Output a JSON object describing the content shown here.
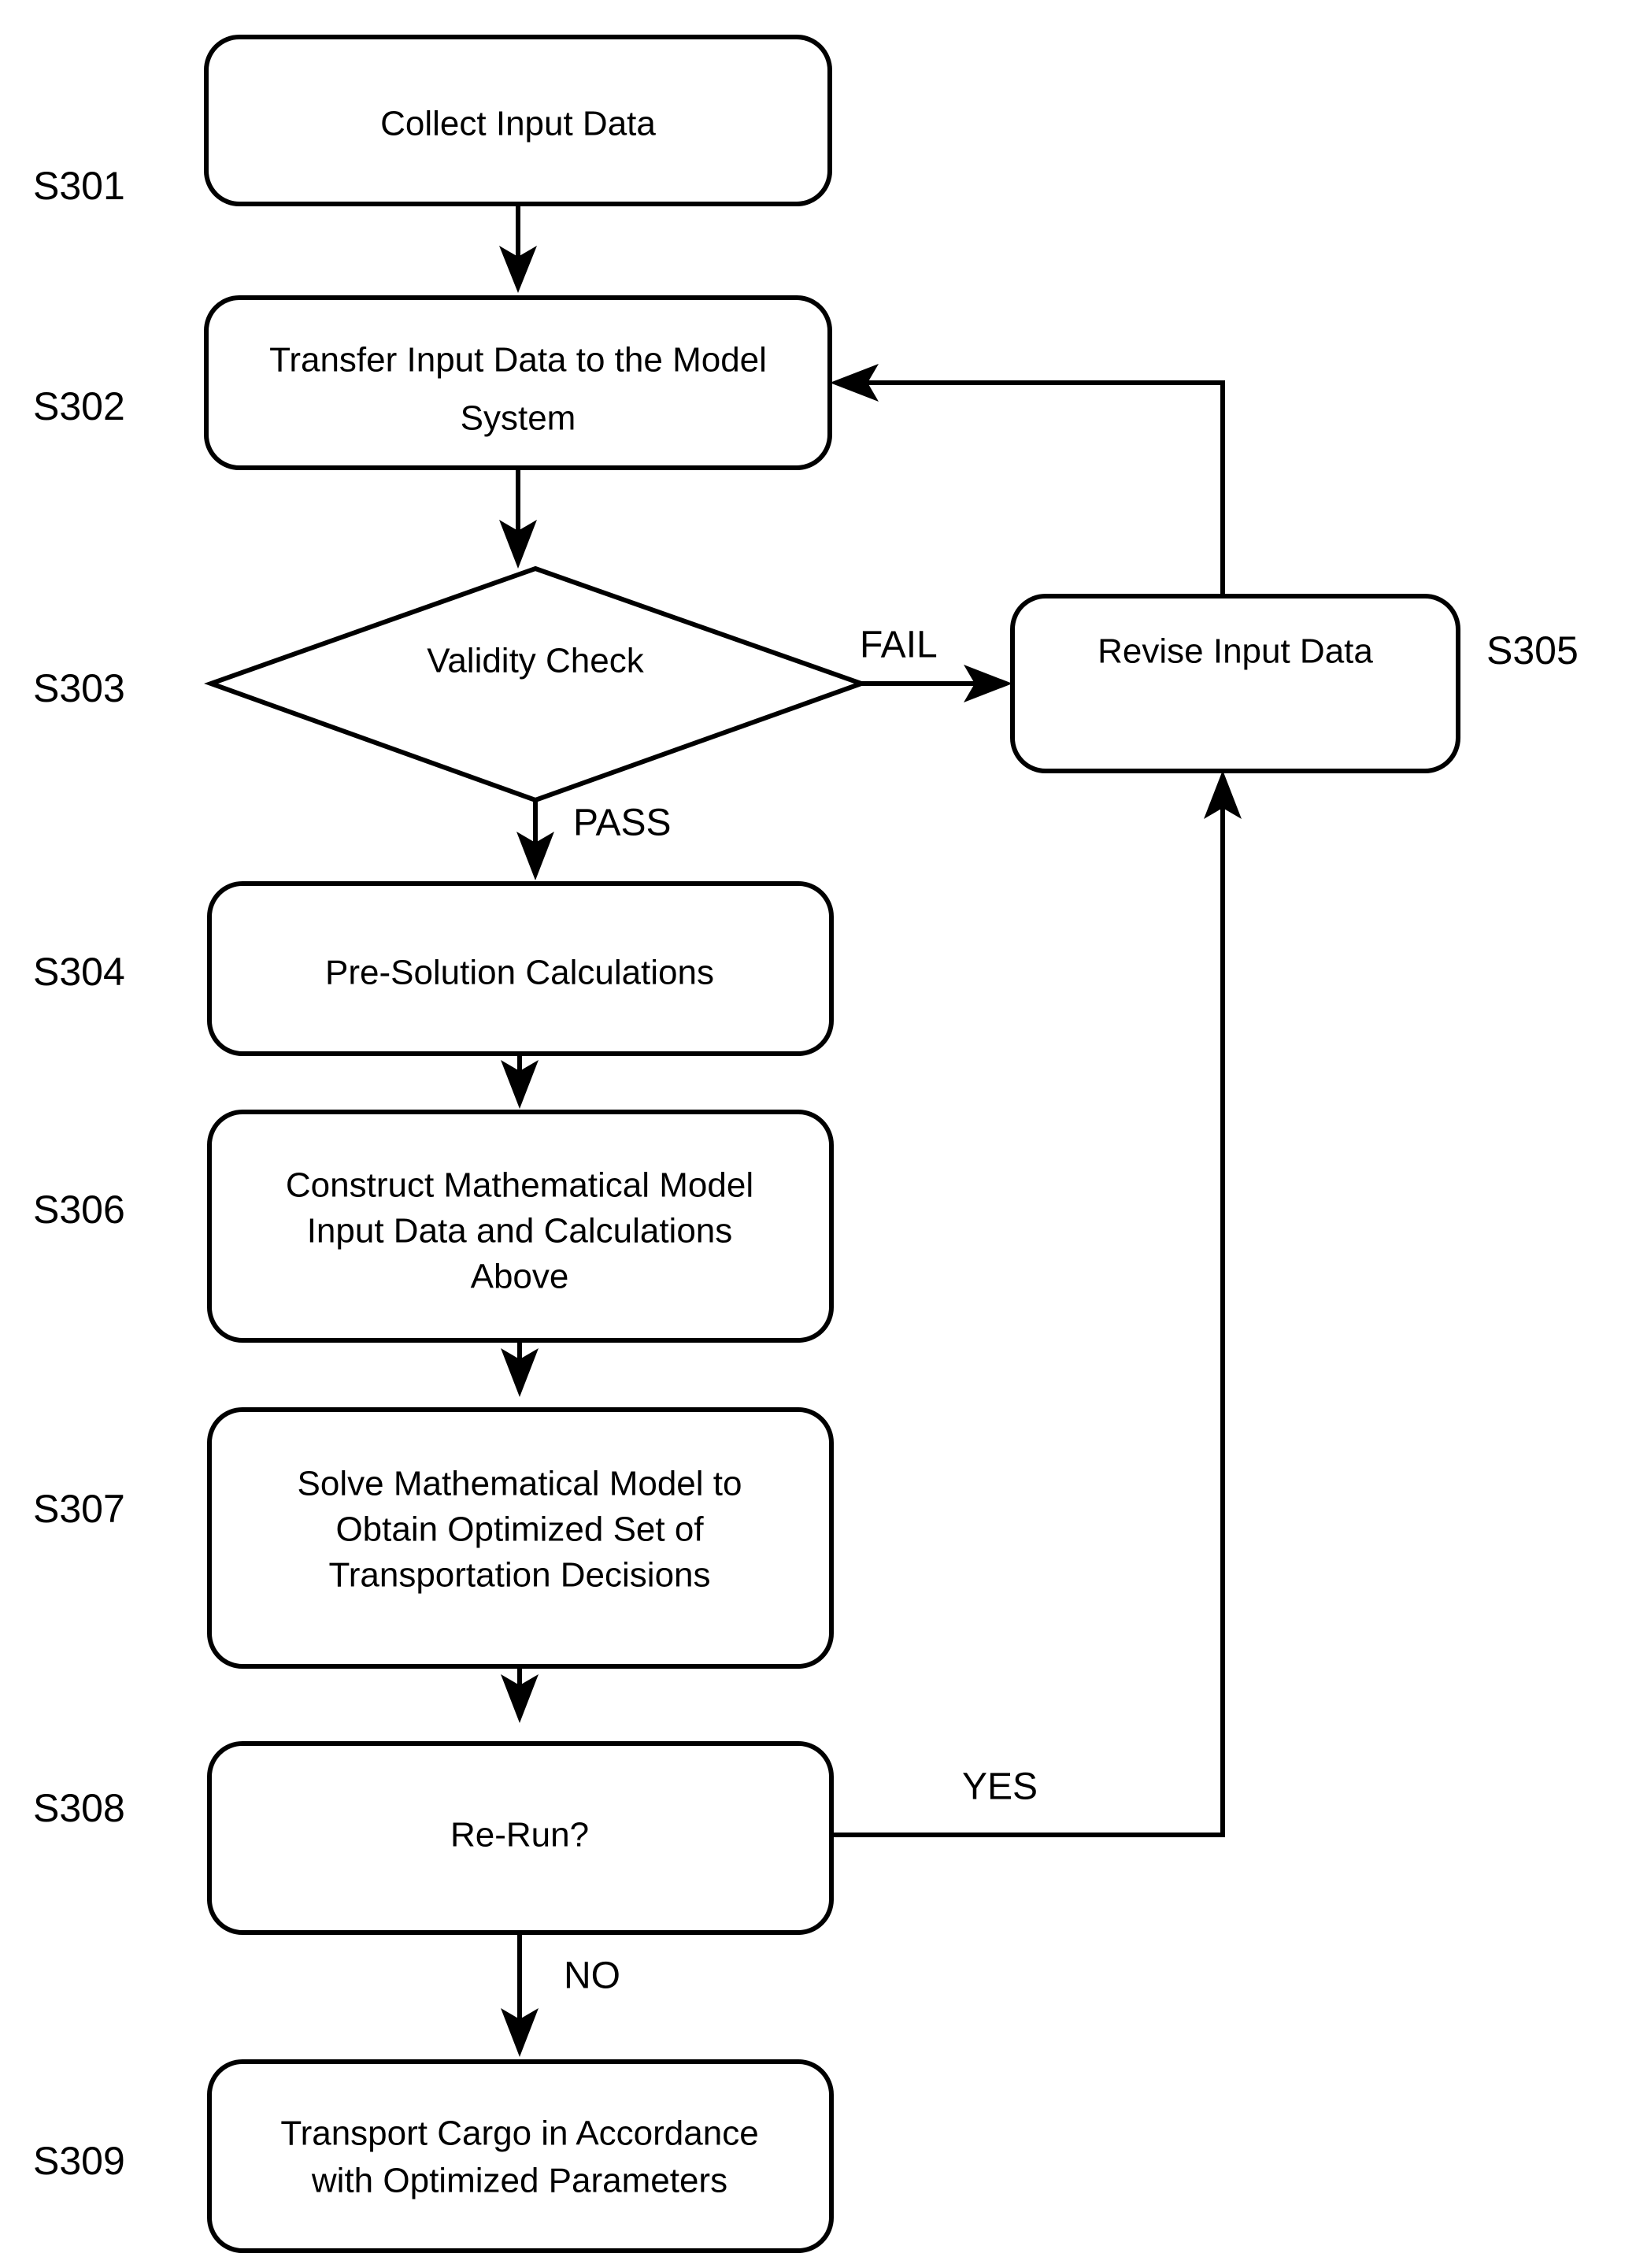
{
  "diagram": {
    "type": "flowchart",
    "title": "",
    "background_color": "#ffffff",
    "line_color": "#000000",
    "text_color": "#000000"
  },
  "nodes": [
    {
      "id": "S301",
      "step_label": "S301",
      "shape": "rounded-rectangle",
      "lines": [
        "Collect Input Data"
      ],
      "line1": "Collect Input Data",
      "line2": "",
      "line3": ""
    },
    {
      "id": "S302",
      "step_label": "S302",
      "shape": "rounded-rectangle",
      "lines": [
        "Transfer Input Data to the Model",
        "System"
      ],
      "line1": "Transfer Input Data to the Model",
      "line2": "System",
      "line3": ""
    },
    {
      "id": "S303",
      "step_label": "S303",
      "shape": "diamond",
      "lines": [
        "Validity Check"
      ],
      "line1": "Validity Check",
      "line2": "",
      "line3": ""
    },
    {
      "id": "S305",
      "step_label": "S305",
      "shape": "rounded-rectangle",
      "lines": [
        "Revise Input Data"
      ],
      "line1": "Revise Input Data",
      "line2": "",
      "line3": ""
    },
    {
      "id": "S304",
      "step_label": "S304",
      "shape": "rounded-rectangle",
      "lines": [
        "Pre-Solution Calculations"
      ],
      "line1": "Pre-Solution Calculations",
      "line2": "",
      "line3": ""
    },
    {
      "id": "S306",
      "step_label": "S306",
      "shape": "rounded-rectangle",
      "lines": [
        "Construct Mathematical Model",
        "Input Data and Calculations",
        "Above"
      ],
      "line1": "Construct Mathematical Model",
      "line2": "Input Data and Calculations",
      "line3": "Above"
    },
    {
      "id": "S307",
      "step_label": "S307",
      "shape": "rounded-rectangle",
      "lines": [
        "Solve Mathematical Model to",
        "Obtain Optimized Set of",
        "Transportation Decisions"
      ],
      "line1": "Solve Mathematical Model to",
      "line2": "Obtain Optimized Set of",
      "line3": "Transportation Decisions"
    },
    {
      "id": "S308",
      "step_label": "S308",
      "shape": "rounded-rectangle",
      "lines": [
        "Re-Run?"
      ],
      "line1": "Re-Run?",
      "line2": "",
      "line3": ""
    },
    {
      "id": "S309",
      "step_label": "S309",
      "shape": "rounded-rectangle",
      "lines": [
        "Transport Cargo in Accordance",
        "with Optimized Parameters"
      ],
      "line1": "Transport Cargo in Accordance",
      "line2": "with Optimized Parameters",
      "line3": ""
    }
  ],
  "edge_labels": {
    "fail": "FAIL",
    "pass": "PASS",
    "yes": "YES",
    "no": "NO"
  },
  "edges": [
    {
      "from": "S301",
      "to": "S302",
      "label": ""
    },
    {
      "from": "S302",
      "to": "S303",
      "label": ""
    },
    {
      "from": "S303",
      "to": "S305",
      "label": "FAIL"
    },
    {
      "from": "S303",
      "to": "S304",
      "label": "PASS"
    },
    {
      "from": "S305",
      "to": "S302",
      "label": ""
    },
    {
      "from": "S304",
      "to": "S306",
      "label": ""
    },
    {
      "from": "S306",
      "to": "S307",
      "label": ""
    },
    {
      "from": "S307",
      "to": "S308",
      "label": ""
    },
    {
      "from": "S308",
      "to": "S305",
      "label": "YES"
    },
    {
      "from": "S308",
      "to": "S309",
      "label": "NO"
    }
  ]
}
